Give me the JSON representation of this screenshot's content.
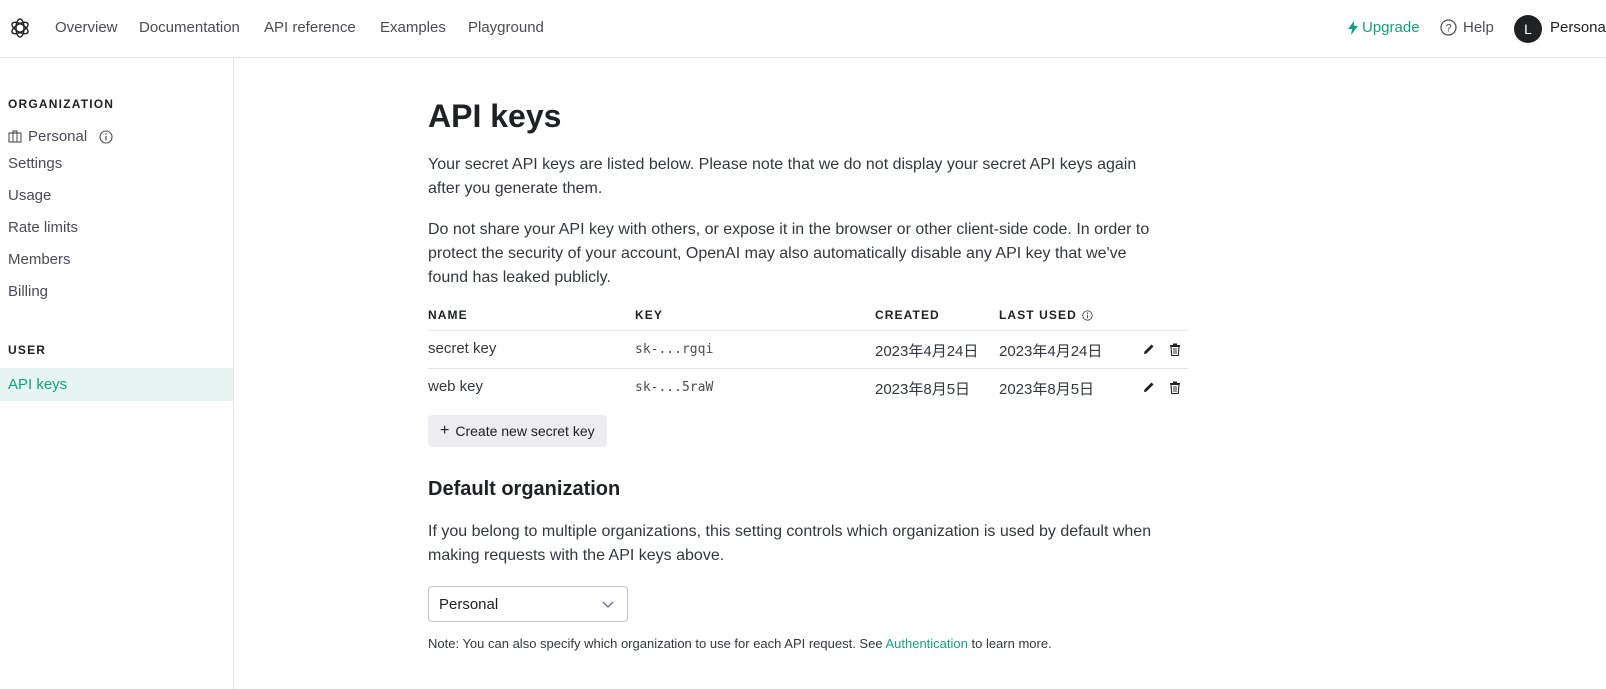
{
  "nav": {
    "links": [
      "Overview",
      "Documentation",
      "API reference",
      "Examples",
      "Playground"
    ],
    "upgrade": "Upgrade",
    "help": "Help",
    "avatar_initial": "L",
    "account": "Personal"
  },
  "sidebar": {
    "org_heading": "ORGANIZATION",
    "org_name": "Personal",
    "org_items": [
      "Settings",
      "Usage",
      "Rate limits",
      "Members",
      "Billing"
    ],
    "user_heading": "USER",
    "active_item": "API keys"
  },
  "main": {
    "title": "API keys",
    "para1": "Your secret API keys are listed below. Please note that we do not display your secret API keys again after you generate them.",
    "para2": "Do not share your API key with others, or expose it in the browser or other client-side code. In order to protect the security of your account, OpenAI may also automatically disable any API key that we've found has leaked publicly.",
    "table": {
      "headers": [
        "NAME",
        "KEY",
        "CREATED",
        "LAST USED"
      ],
      "rows": [
        {
          "name": "secret key",
          "key": "sk-...rgqi",
          "created": "2023年4月24日",
          "last_used": "2023年4月24日"
        },
        {
          "name": "web key",
          "key": "sk-...5raW",
          "created": "2023年8月5日",
          "last_used": "2023年8月5日"
        }
      ]
    },
    "create_button": "Create new secret key",
    "default_org_title": "Default organization",
    "default_org_text": "If you belong to multiple organizations, this setting controls which organization is used by default when making requests with the API keys above.",
    "select_value": "Personal",
    "note_prefix": "Note: You can also specify which organization to use for each API request. See ",
    "note_link": "Authentication",
    "note_suffix": " to learn more."
  },
  "colors": {
    "accent": "#10a37f",
    "active_bg": "#e6f5f1",
    "button_bg": "#ececf1",
    "border": "#e5e5e5"
  }
}
